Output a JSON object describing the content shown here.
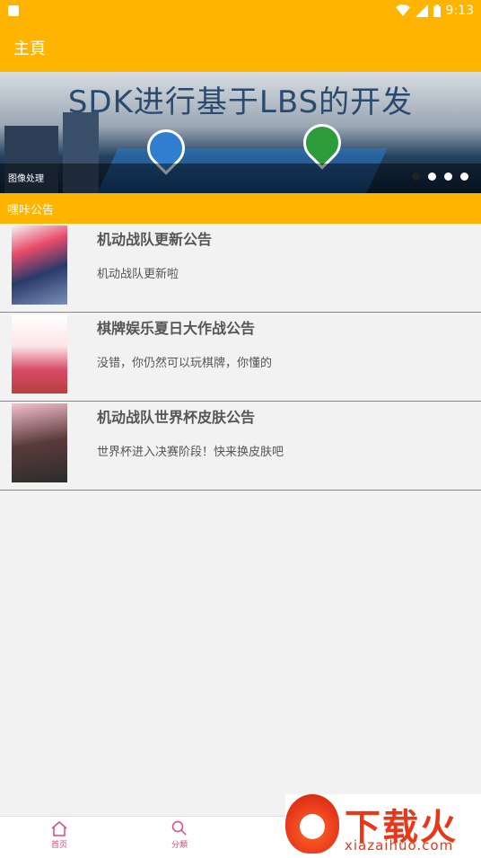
{
  "status_bar": {
    "time": "9:13"
  },
  "app_bar": {
    "title": "主頁"
  },
  "banner": {
    "headline": "SDK进行基于LBS的开发",
    "caption": "图像处理",
    "dots": [
      true,
      false,
      false,
      false
    ]
  },
  "section": {
    "title": "嘿咔公告"
  },
  "announcements": [
    {
      "title": "机动战队更新公告",
      "desc": "机动战队更新啦"
    },
    {
      "title": "棋牌娱乐夏日大作战公告",
      "desc": "没错，你仍然可以玩棋牌，你懂的"
    },
    {
      "title": "机动战队世界杯皮肤公告",
      "desc": "世界杯进入决赛阶段！快来换皮肤吧"
    }
  ],
  "bottom_nav": [
    {
      "label": "首页",
      "icon": "home-icon"
    },
    {
      "label": "分類",
      "icon": "search-icon"
    }
  ],
  "watermark": {
    "text": "下载火",
    "url": "xiazaihuo.com"
  },
  "colors": {
    "accent": "#ffb400",
    "nav_pink": "#e0497a",
    "watermark_red": "#e8381a"
  }
}
